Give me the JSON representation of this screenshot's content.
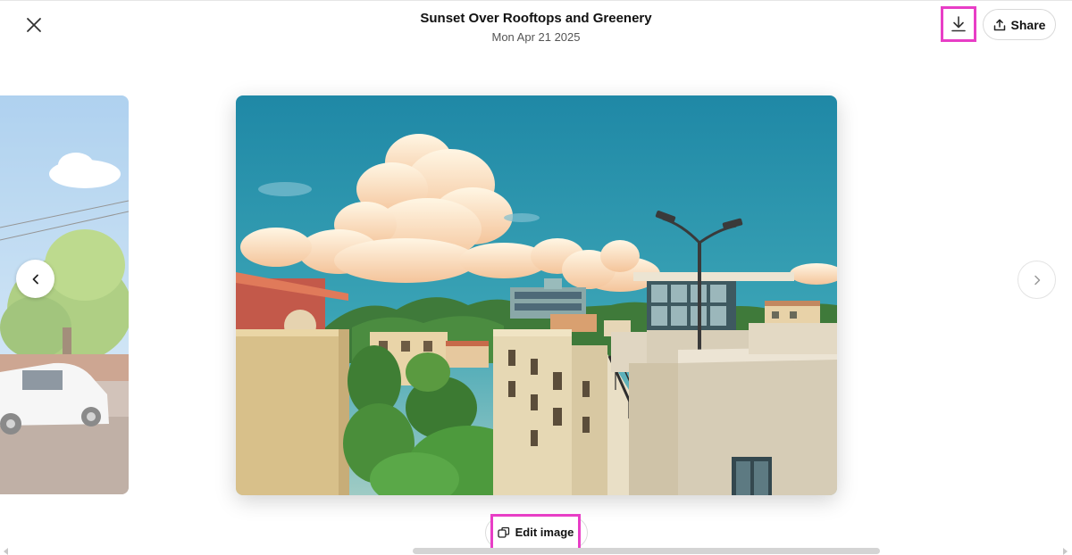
{
  "header": {
    "title": "Sunset Over Rooftops and Greenery",
    "date": "Mon Apr 21 2025",
    "share_label": "Share"
  },
  "footer": {
    "edit_label": "Edit image"
  },
  "icons": {
    "close": "close-icon",
    "download": "download-icon",
    "share": "share-icon",
    "edit": "edit-image-icon",
    "prev": "chevron-left-icon",
    "next": "chevron-right-icon"
  },
  "colors": {
    "highlight": "#e83ec6",
    "sky": "#2a8ea8"
  }
}
